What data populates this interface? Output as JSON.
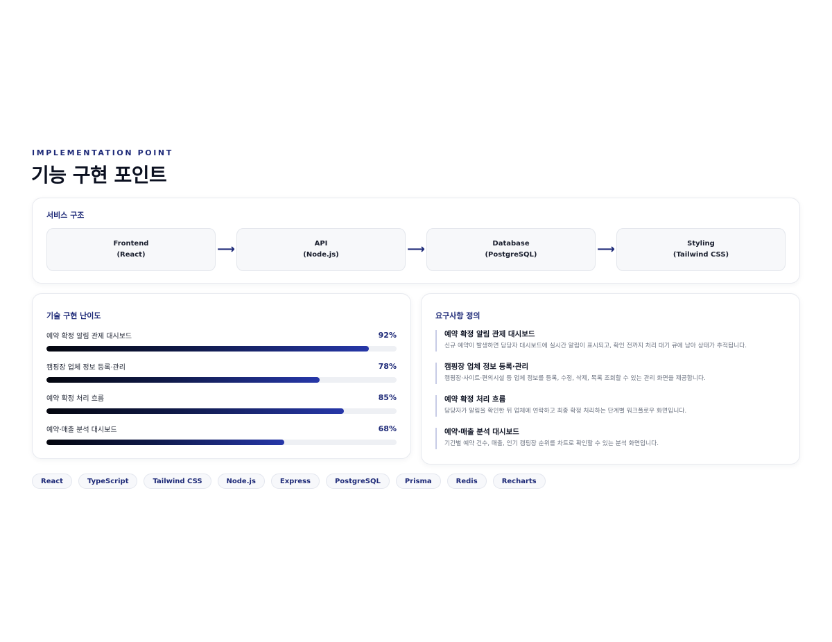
{
  "header": {
    "eyebrow": "IMPLEMENTATION POINT",
    "title": "기능 구현 포인트"
  },
  "structure": {
    "title": "서비스 구조",
    "nodes": [
      {
        "name": "Frontend",
        "detail": "(React)"
      },
      {
        "name": "API",
        "detail": "(Node.js)"
      },
      {
        "name": "Database",
        "detail": "(PostgreSQL)"
      },
      {
        "name": "Styling",
        "detail": "(Tailwind CSS)"
      }
    ],
    "arrow": "⟶"
  },
  "difficulty": {
    "title": "기술 구현 난이도",
    "items": [
      {
        "label": "예약 확정 알림 관제 대시보드",
        "percent_text": "92%",
        "value": 92
      },
      {
        "label": "캠핑장 업체 정보 등록·관리",
        "percent_text": "78%",
        "value": 78
      },
      {
        "label": "예약 확정 처리 흐름",
        "percent_text": "85%",
        "value": 85
      },
      {
        "label": "예약·매출 분석 대시보드",
        "percent_text": "68%",
        "value": 68
      }
    ]
  },
  "requirements": {
    "title": "요구사항 정의",
    "items": [
      {
        "title": "예약 확정 알림 관제 대시보드",
        "desc": "신규 예약이 발생하면 담당자 대시보드에 실시간 알림이 표시되고, 확인 전까지 처리 대기 큐에 남아 상태가 추적됩니다."
      },
      {
        "title": "캠핑장 업체 정보 등록·관리",
        "desc": "캠핑장·사이트·편의시설 등 업체 정보를 등록, 수정, 삭제, 목록 조회할 수 있는 관리 화면을 제공합니다."
      },
      {
        "title": "예약 확정 처리 흐름",
        "desc": "담당자가 알림을 확인한 뒤 업체에 연락하고 최종 확정 처리하는 단계별 워크플로우 화면입니다."
      },
      {
        "title": "예약·매출 분석 대시보드",
        "desc": "기간별 예약 건수, 매출, 인기 캠핑장 순위를 차트로 확인할 수 있는 분석 화면입니다."
      }
    ]
  },
  "tags": [
    "React",
    "TypeScript",
    "Tailwind CSS",
    "Node.js",
    "Express",
    "PostgreSQL",
    "Prisma",
    "Redis",
    "Recharts"
  ],
  "colors": {
    "accent": "#1e2a78",
    "bar_start": "#04060e",
    "bar_end": "#2637a8"
  }
}
